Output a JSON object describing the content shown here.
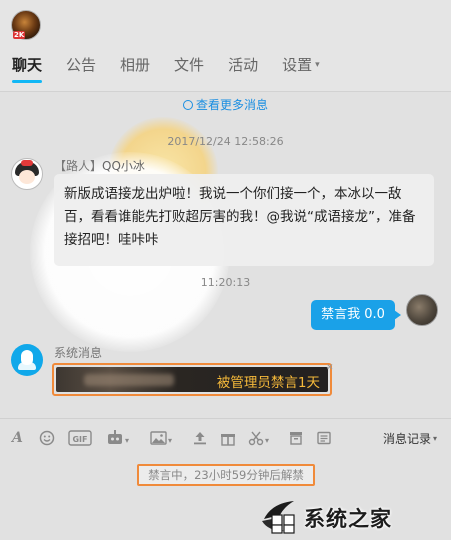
{
  "header": {
    "group_level": "2K",
    "tabs": [
      {
        "label": "聊天"
      },
      {
        "label": "公告"
      },
      {
        "label": "相册"
      },
      {
        "label": "文件"
      },
      {
        "label": "活动"
      },
      {
        "label": "设置"
      }
    ],
    "active_tab": "聊天"
  },
  "chat": {
    "more_messages": "查看更多消息",
    "timestamp_1": "2017/12/24 12:58:26",
    "bot_message": {
      "role": "【路人】",
      "name": "QQ小冰",
      "text": "新版成语接龙出炉啦！我说一个你们接一个，本冰以一敌百，看看谁能先打败超厉害的我！@我说“成语接龙”，准备接招吧！哇咔咔"
    },
    "timestamp_2": "11:20:13",
    "self_message": {
      "text": "禁言我 0.0"
    },
    "system_message": {
      "label": "系统消息",
      "text": "被管理员禁言1天"
    }
  },
  "toolbar": {
    "icons": [
      "font-icon",
      "emoji-icon",
      "gif-icon",
      "robot-icon",
      "image-icon",
      "upload-icon",
      "gift-icon",
      "scissors-icon",
      "archive-icon",
      "more-icon"
    ],
    "history_label": "消息记录"
  },
  "bottom": {
    "ban_status": "禁言中，23小时59分钟后解禁",
    "watermark_text": "系统之家"
  },
  "colors": {
    "accent": "#12b7f5",
    "self_bubble": "#1aa1e8",
    "highlight_border": "#f08a3a",
    "ban_text": "#f5b93a"
  }
}
